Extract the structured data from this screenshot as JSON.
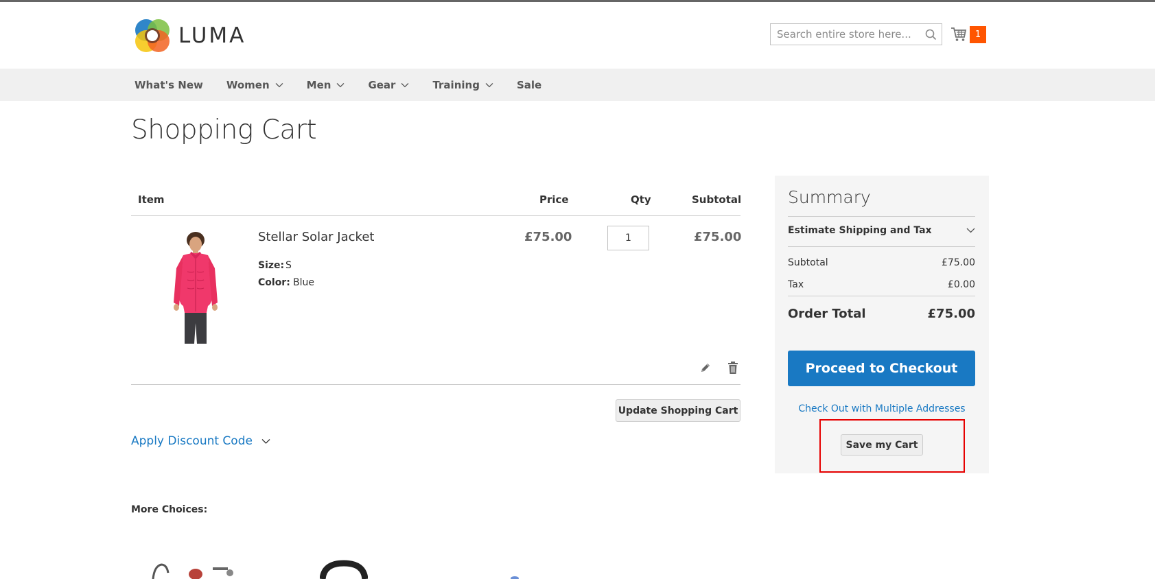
{
  "header": {
    "logo_text": "LUMA",
    "search_placeholder": "Search entire store here...",
    "cart_count": "1"
  },
  "nav": {
    "items": [
      {
        "label": "What's New",
        "has_dropdown": false
      },
      {
        "label": "Women",
        "has_dropdown": true
      },
      {
        "label": "Men",
        "has_dropdown": true
      },
      {
        "label": "Gear",
        "has_dropdown": true
      },
      {
        "label": "Training",
        "has_dropdown": true
      },
      {
        "label": "Sale",
        "has_dropdown": false
      }
    ]
  },
  "page": {
    "title": "Shopping Cart"
  },
  "cart": {
    "columns": {
      "item": "Item",
      "price": "Price",
      "qty": "Qty",
      "subtotal": "Subtotal"
    },
    "items": [
      {
        "name": "Stellar Solar Jacket",
        "options": [
          {
            "label": "Size:",
            "value": "S"
          },
          {
            "label": "Color:",
            "value": "Blue"
          }
        ],
        "price": "£75.00",
        "qty": "1",
        "subtotal": "£75.00"
      }
    ],
    "update_label": "Update Shopping Cart",
    "discount_label": "Apply Discount Code",
    "more_choices_label": "More Choices:"
  },
  "summary": {
    "title": "Summary",
    "estimate_label": "Estimate Shipping and Tax",
    "subtotal_label": "Subtotal",
    "subtotal_value": "£75.00",
    "tax_label": "Tax",
    "tax_value": "£0.00",
    "order_total_label": "Order Total",
    "order_total_value": "£75.00",
    "checkout_label": "Proceed to Checkout",
    "multi_address_label": "Check Out with Multiple Addresses",
    "save_cart_label": "Save my Cart"
  },
  "colors": {
    "accent": "#1979c3",
    "cart_badge": "#ff5501",
    "highlight": "#e60000",
    "nav_bg": "#f0f0f0"
  },
  "icons": [
    "luma-logo-icon",
    "search-icon",
    "cart-icon",
    "chevron-down-icon",
    "edit-icon",
    "trash-icon"
  ]
}
